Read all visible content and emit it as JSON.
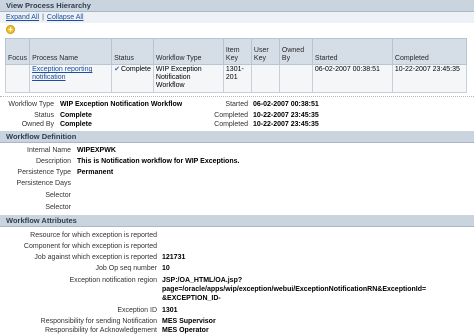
{
  "hierarchy": {
    "title": "View Process Hierarchy",
    "expand_all": "Expand All",
    "separator": "|",
    "collapse_all": "Collapse All",
    "columns": [
      "Focus",
      "Process Name",
      "Status",
      "Workflow Type",
      "Item Key",
      "User Key",
      "Owned By",
      "Started",
      "Completed"
    ],
    "row": {
      "focus": "",
      "process_name": "Exception reporting notification",
      "status": "Complete",
      "workflow_type": "WIP Exception Notification Workflow",
      "item_key": "1301-201",
      "user_key": "",
      "owned_by": "",
      "started": "06-02-2007 00:38:51",
      "completed": "10-22-2007 23:45:35"
    }
  },
  "summary": {
    "workflow_type_label": "Workflow Type",
    "workflow_type_value": "WIP Exception Notification Workflow",
    "status_label": "Status",
    "status_value": "Complete",
    "owned_by_label": "Owned By",
    "owned_by_value": "Complete",
    "started_label": "Started",
    "started_value": "06-02-2007 00:38:51",
    "completed_label": "Completed",
    "completed_value": "10-22-2007 23:45:35",
    "completed2_label": "Completed",
    "completed2_value": "10-22-2007 23:45:35"
  },
  "definition": {
    "title": "Workflow Definition",
    "internal_name_label": "Internal Name",
    "internal_name_value": "WIPEXPWK",
    "description_label": "Description",
    "description_value": "This is Notification workflow for WIP Exceptions.",
    "persistence_type_label": "Persistence Type",
    "persistence_type_value": "Permanent",
    "persistence_days_label": "Persistence Days",
    "selector_label": "Selector",
    "selector2_label": "Selector"
  },
  "attributes": {
    "title": "Workflow Attributes",
    "items": [
      {
        "label": "Resource for which exception is reported",
        "value": ""
      },
      {
        "label": "Component for which exception is reported",
        "value": ""
      },
      {
        "label": "Job against which exception is reported",
        "value": "121731"
      },
      {
        "label": "Job Op seq number",
        "value": "10"
      },
      {
        "label": "Exception notification region",
        "value": "JSP:/OA_HTML/OA.jsp?"
      },
      {
        "label": "",
        "value": "page=/oracle/apps/wip/exception/webui/ExceptionNotificationRN&ExceptionId="
      },
      {
        "label": "",
        "value": "&EXCEPTION_ID-"
      },
      {
        "label": "Exception ID",
        "value": "1301"
      },
      {
        "label": "Responsibility for sending Notification",
        "value": "MES Supervisor"
      },
      {
        "label": "Responsibility for Acknowledgement",
        "value": "MES Operator"
      }
    ]
  }
}
